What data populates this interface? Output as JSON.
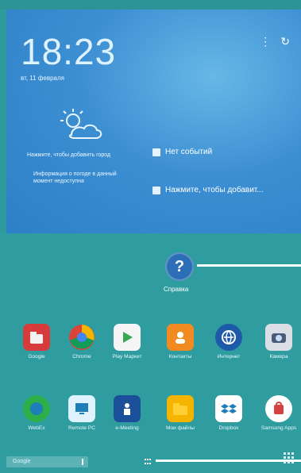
{
  "home": {
    "time": "18:23",
    "date": "вт, 11 февраля",
    "weather": {
      "tap_to_add_city": "Нажмите, чтобы добавить город",
      "weather_unavailable": "Информация о погоде в данный момент недоступна",
      "icon": "partly-cloudy-icon"
    },
    "events": {
      "no_events": "Нет событий",
      "tap_to_add": "Нажмите, чтобы добавит..."
    },
    "help": {
      "label": "Справка"
    },
    "apps_row1": [
      {
        "label": "Google",
        "icon": "google-folder-icon"
      },
      {
        "label": "Chrome",
        "icon": "chrome-icon"
      },
      {
        "label": "Play Маркет",
        "icon": "play-store-icon"
      },
      {
        "label": "Контакты",
        "icon": "contacts-icon"
      },
      {
        "label": "Интернет",
        "icon": "internet-globe-icon"
      },
      {
        "label": "Камера",
        "icon": "camera-icon"
      }
    ],
    "apps_row2": [
      {
        "label": "WebEx",
        "icon": "webex-icon"
      },
      {
        "label": "Remote PC",
        "icon": "remote-pc-icon"
      },
      {
        "label": "e-Meeting",
        "icon": "e-meeting-icon"
      },
      {
        "label": "Мои файлы",
        "icon": "folder-icon"
      },
      {
        "label": "Dropbox",
        "icon": "dropbox-icon"
      },
      {
        "label": "Samsung Apps",
        "icon": "samsung-apps-icon"
      }
    ],
    "dock": {
      "search_label": "Google",
      "mic_icon": "mic-icon",
      "grid_icon": "home-pages-icon",
      "apps_icon": "apps-grid-icon"
    }
  },
  "colors": {
    "top_gradient": "#3d8fd3",
    "bottom_teal": "#2f9d9f",
    "help_blue": "#2d6fb7"
  }
}
